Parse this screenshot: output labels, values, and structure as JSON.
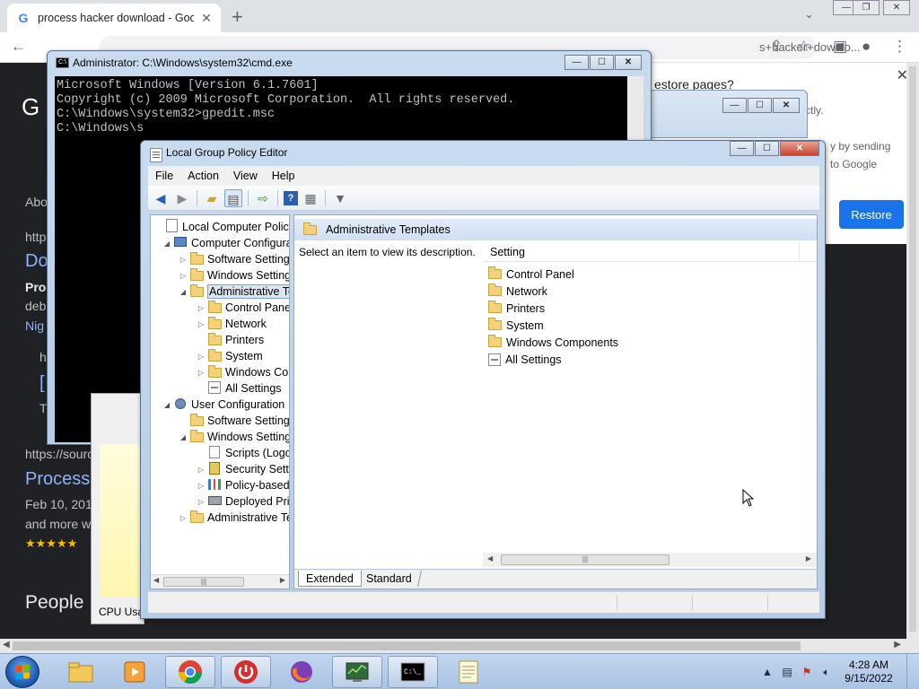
{
  "chrome": {
    "tab_title": "process hacker download - Goog",
    "tab_close": "✕",
    "new_tab": "+",
    "url": "s+hacker+downlo...",
    "restore_popup": {
      "question": "estore pages?",
      "line_partial": "ctly.",
      "text1": "y by sending",
      "text2": "to Google",
      "restore_button": "Restore"
    },
    "page": {
      "logo": "G",
      "about": "Abo",
      "http": "http",
      "link1": "Do",
      "pro": "Pro",
      "deb": "deb",
      "nig": "Nig",
      "h": "h",
      "l": "[",
      "t": "T",
      "source_url": "https://sourc",
      "process_link": "Process",
      "date": "Feb 10, 201",
      "and_more": "and more w",
      "stars": "★★★★★",
      "people": "People"
    }
  },
  "cmd": {
    "title": "Administrator: C:\\Windows\\system32\\cmd.exe",
    "icon_text": "C:\\",
    "lines": [
      "Microsoft Windows [Version 6.1.7601]",
      "Copyright (c) 2009 Microsoft Corporation.  All rights reserved.",
      "",
      "C:\\Windows\\system32>gpedit.msc",
      "",
      "C:\\Windows\\s"
    ]
  },
  "taskmgr": {
    "label": "CPU Usa"
  },
  "gpe": {
    "title": "Local Group Policy Editor",
    "menu": [
      "File",
      "Action",
      "View",
      "Help"
    ],
    "toolbar_icons": [
      "back-icon",
      "forward-icon",
      "up-folder-icon",
      "show-hide-tree-icon",
      "export-list-icon",
      "help-icon",
      "properties-icon",
      "filter-icon"
    ],
    "tree": [
      {
        "label": "Local Computer Policy",
        "level": 0,
        "expander": "",
        "icon": "policy",
        "selected": false
      },
      {
        "label": "Computer Configura",
        "level": 1,
        "expander": "◢",
        "icon": "computer",
        "selected": false
      },
      {
        "label": "Software Settings",
        "level": 2,
        "expander": "▷",
        "icon": "folder",
        "selected": false
      },
      {
        "label": "Windows Setting",
        "level": 2,
        "expander": "▷",
        "icon": "folder",
        "selected": false
      },
      {
        "label": "Administrative Te",
        "level": 2,
        "expander": "◢",
        "icon": "folder",
        "selected": true
      },
      {
        "label": "Control Panel",
        "level": 3,
        "expander": "▷",
        "icon": "folder",
        "selected": false
      },
      {
        "label": "Network",
        "level": 3,
        "expander": "▷",
        "icon": "folder",
        "selected": false
      },
      {
        "label": "Printers",
        "level": 3,
        "expander": "",
        "icon": "folder",
        "selected": false
      },
      {
        "label": "System",
        "level": 3,
        "expander": "▷",
        "icon": "folder",
        "selected": false
      },
      {
        "label": "Windows Cor",
        "level": 3,
        "expander": "▷",
        "icon": "folder",
        "selected": false
      },
      {
        "label": "All Settings",
        "level": 3,
        "expander": "",
        "icon": "settings",
        "selected": false
      },
      {
        "label": "User Configuration",
        "level": 1,
        "expander": "◢",
        "icon": "user",
        "selected": false
      },
      {
        "label": "Software Settings",
        "level": 2,
        "expander": "",
        "icon": "folder",
        "selected": false
      },
      {
        "label": "Windows Setting",
        "level": 2,
        "expander": "◢",
        "icon": "folder",
        "selected": false
      },
      {
        "label": "Scripts (Logo",
        "level": 3,
        "expander": "",
        "icon": "script",
        "selected": false
      },
      {
        "label": "Security Setti",
        "level": 3,
        "expander": "▷",
        "icon": "security",
        "selected": false
      },
      {
        "label": "Policy-based",
        "level": 3,
        "expander": "▷",
        "icon": "chart",
        "selected": false
      },
      {
        "label": "Deployed Prir",
        "level": 3,
        "expander": "▷",
        "icon": "printer",
        "selected": false
      },
      {
        "label": "Administrative Te",
        "level": 2,
        "expander": "▷",
        "icon": "folder",
        "selected": false
      }
    ],
    "pane_title": "Administrative Templates",
    "description": "Select an item to view its description.",
    "column_setting": "Setting",
    "items": [
      {
        "label": "Control Panel",
        "icon": "folder"
      },
      {
        "label": "Network",
        "icon": "folder"
      },
      {
        "label": "Printers",
        "icon": "folder"
      },
      {
        "label": "System",
        "icon": "folder"
      },
      {
        "label": "Windows Components",
        "icon": "folder"
      },
      {
        "label": "All Settings",
        "icon": "settings"
      }
    ],
    "tab_extended": "Extended",
    "tab_standard": "Standard"
  },
  "taskbar": {
    "apps": [
      "explorer-icon",
      "media-player-icon",
      "chrome-icon",
      "power-icon",
      "firefox-icon",
      "system-monitor-icon",
      "cmd-icon",
      "notepad-icon"
    ],
    "time": "4:28 AM",
    "date": "9/15/2022",
    "tray_arrow": "▲"
  }
}
